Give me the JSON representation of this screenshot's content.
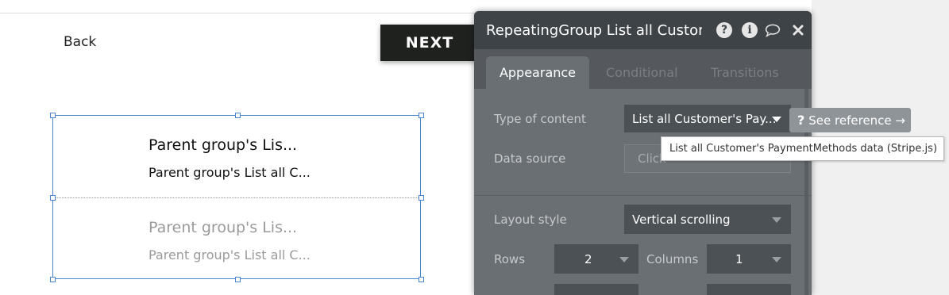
{
  "canvas": {
    "back_label": "Back",
    "next_label": "NEXT",
    "repeating_group": {
      "rows": [
        {
          "line1": "Parent group's Lis...",
          "line2": "Parent group's List all C..."
        },
        {
          "line1": "Parent group's Lis...",
          "line2": "Parent group's List all C..."
        }
      ]
    }
  },
  "panel": {
    "title": "RepeatingGroup List all Customer",
    "icons": [
      "help-icon",
      "info-icon",
      "comment-icon",
      "close-icon"
    ],
    "tabs": [
      {
        "label": "Appearance",
        "active": true
      },
      {
        "label": "Conditional",
        "active": false
      },
      {
        "label": "Transitions",
        "active": false
      }
    ],
    "fields": {
      "type_of_content": {
        "label": "Type of content",
        "value": "List all Customer's Pay..."
      },
      "data_source": {
        "label": "Data source",
        "placeholder": "Click"
      },
      "layout_style": {
        "label": "Layout style",
        "value": "Vertical scrolling"
      },
      "rows": {
        "label": "Rows",
        "value": "2"
      },
      "columns": {
        "label": "Columns",
        "value": "1"
      }
    },
    "see_reference": "See reference →",
    "tooltip": "List all Customer's PaymentMethods data (Stripe.js)"
  },
  "colors": {
    "panel_bg": "#6a6f73",
    "panel_header": "#3e4347",
    "selection_blue": "#4a86d0",
    "next_button_bg": "#1f211f"
  }
}
